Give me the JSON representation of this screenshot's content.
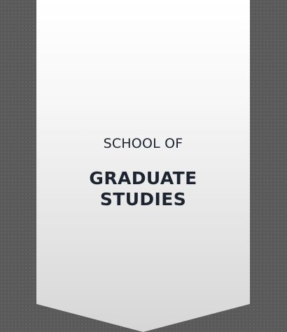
{
  "banner": {
    "eyebrow": "SCHOOL OF",
    "headline_line1": "GRADUATE",
    "headline_line2": "STUDIES"
  },
  "colors": {
    "background": "#5a5a5a",
    "banner_top": "#ffffff",
    "banner_bottom": "#dcdcdc",
    "text": "#1c2430"
  }
}
